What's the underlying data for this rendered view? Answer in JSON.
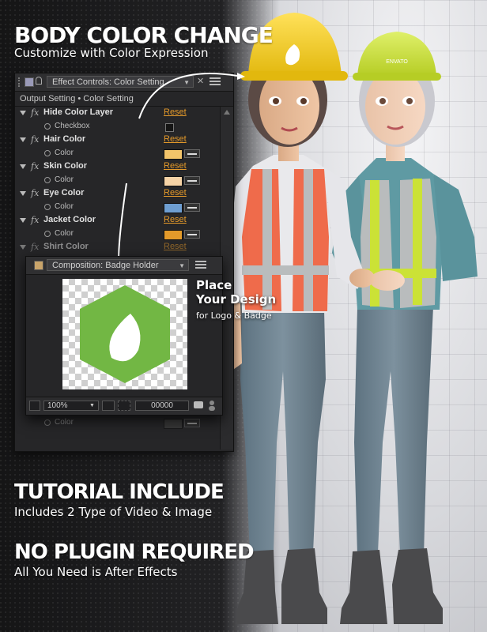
{
  "headline1": {
    "title": "BODY COLOR CHANGE",
    "subtitle": "Customize with Color Expression"
  },
  "effect_controls": {
    "tab_title": "Effect Controls: Color Setting",
    "path": "Output Setting • Color Setting",
    "reset_label": "Reset",
    "fx_symbol": "fx",
    "rows": [
      {
        "label": "Hide Color Layer",
        "sub_label": "Checkbox"
      },
      {
        "label": "Hair Color",
        "sub_label": "Color",
        "color": "#f2c46a"
      },
      {
        "label": "Skin Color",
        "sub_label": "Color",
        "color": "#f6d3a6"
      },
      {
        "label": "Eye Color",
        "sub_label": "Color",
        "color": "#6e9ed1"
      },
      {
        "label": "Jacket Color",
        "sub_label": "Color",
        "color": "#e39a2a"
      },
      {
        "label": "Shirt Color",
        "sub_label": "",
        "color": ""
      }
    ],
    "bottom_sub_label": "Color"
  },
  "composition": {
    "tab_title": "Composition: Badge Holder",
    "zoom": "100%",
    "timecode": "00000",
    "logo_color": "#72b744"
  },
  "place_callout": {
    "line1": "Place",
    "line2": "Your Design",
    "line3": "for Logo & Badge"
  },
  "headline2": {
    "title": "TUTORIAL INCLUDE",
    "subtitle": "Includes 2 Type of Video & Image"
  },
  "headline3": {
    "title": "NO PLUGIN REQUIRED",
    "subtitle": "All You Need is After Effects"
  },
  "helmet_logo_text": "ENVATO",
  "colors": {
    "yellow_helmet": "#f4cf1d",
    "green_helmet": "#c9e03a",
    "orange_vest": "#ef6b4b",
    "grey_vest": "#b9bcbd",
    "green_stripe": "#cbe236",
    "jeans": "#6f8593",
    "teal_shirt": "#5f9aa3"
  }
}
